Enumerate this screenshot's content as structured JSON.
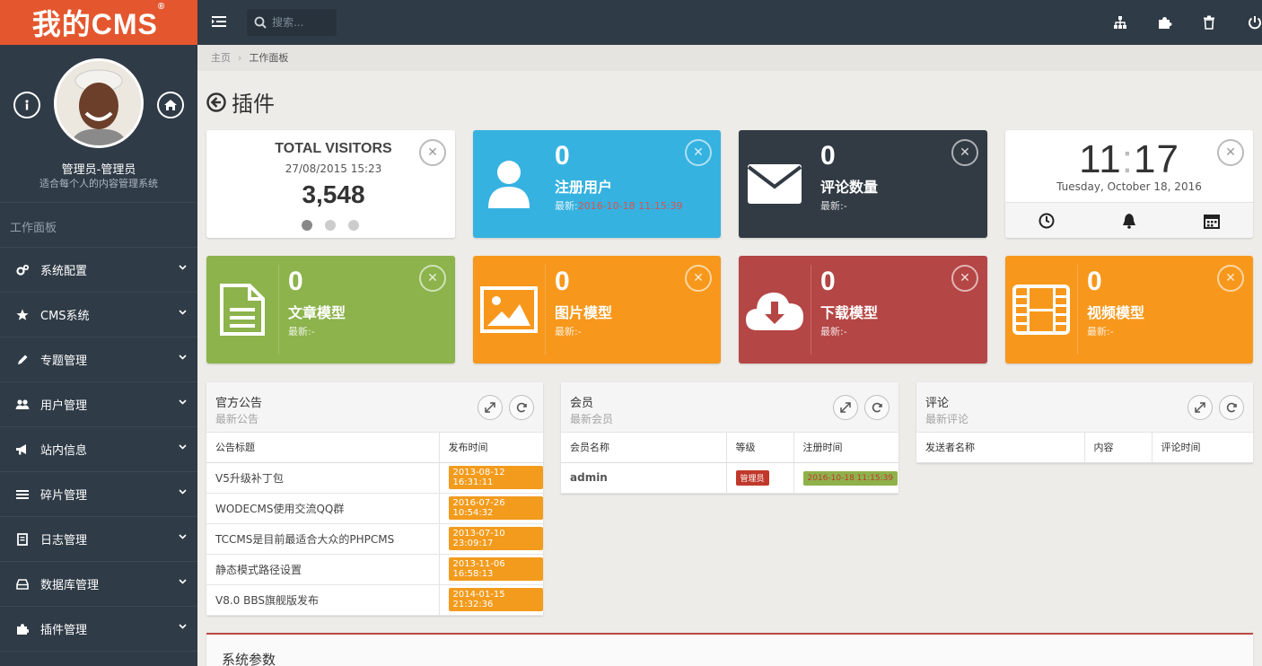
{
  "brand": {
    "logo": "我的CMS",
    "logo_mark": "®"
  },
  "profile": {
    "name": "管理员-管理员",
    "subtitle": "适合每个人的内容管理系统"
  },
  "nav": {
    "section": "工作面板",
    "items": [
      {
        "label": "系统配置",
        "icon": "cogs-icon"
      },
      {
        "label": "CMS系统",
        "icon": "star-icon"
      },
      {
        "label": "专题管理",
        "icon": "pencil-icon"
      },
      {
        "label": "用户管理",
        "icon": "users-icon"
      },
      {
        "label": "站内信息",
        "icon": "bullhorn-icon"
      },
      {
        "label": "碎片管理",
        "icon": "list-icon"
      },
      {
        "label": "日志管理",
        "icon": "book-icon"
      },
      {
        "label": "数据库管理",
        "icon": "hdd-icon"
      },
      {
        "label": "插件管理",
        "icon": "puzzle-icon"
      }
    ]
  },
  "topbar": {
    "search_placeholder": "搜索..."
  },
  "breadcrumb": {
    "home": "主页",
    "current": "工作面板"
  },
  "page_title": "插件",
  "visitors": {
    "title": "TOTAL VISITORS",
    "date": "27/08/2015 15:23",
    "count": "3,548"
  },
  "clock": {
    "hour": "11",
    "sep": ":",
    "minute": "17",
    "date": "Tuesday, October 18, 2016"
  },
  "stats": [
    {
      "num": "0",
      "label": "注册用户",
      "meta_prefix": "最新:",
      "meta_value": "2016-10-18 11:15:39",
      "color": "#36b2e0"
    },
    {
      "num": "0",
      "label": "评论数量",
      "meta_prefix": "最新:",
      "meta_value": "-",
      "color": "#323b44"
    },
    {
      "num": "0",
      "label": "文章模型",
      "meta_prefix": "最新:",
      "meta_value": "-",
      "color": "#8cb34c"
    },
    {
      "num": "0",
      "label": "图片模型",
      "meta_prefix": "最新:",
      "meta_value": "-",
      "color": "#f7981c"
    },
    {
      "num": "0",
      "label": "下载模型",
      "meta_prefix": "最新:",
      "meta_value": "-",
      "color": "#b44645"
    },
    {
      "num": "0",
      "label": "视频模型",
      "meta_prefix": "最新:",
      "meta_value": "-",
      "color": "#f7981c"
    }
  ],
  "notices": {
    "title": "官方公告",
    "subtitle": "最新公告",
    "columns": [
      "公告标题",
      "发布时间"
    ],
    "rows": [
      [
        "V5升级补丁包",
        "2013-08-12 16:31:11"
      ],
      [
        "WODECMS使用交流QQ群",
        "2016-07-26 10:54:32"
      ],
      [
        "TCCMS是目前最适合大众的PHPCMS",
        "2013-07-10 23:09:17"
      ],
      [
        "静态模式路径设置",
        "2013-11-06 16:58:13"
      ],
      [
        "V8.0 BBS旗舰版发布",
        "2014-01-15 21:32:36"
      ]
    ]
  },
  "members": {
    "title": "会员",
    "subtitle": "最新会员",
    "columns": [
      "会员名称",
      "等级",
      "注册时间"
    ],
    "rows": [
      [
        "admin",
        "管理员",
        "2016-10-18 11:15:39"
      ]
    ]
  },
  "comments": {
    "title": "评论",
    "subtitle": "最新评论",
    "columns": [
      "发送者名称",
      "内容",
      "评论时间"
    ]
  },
  "system": {
    "title": "系统参数"
  }
}
